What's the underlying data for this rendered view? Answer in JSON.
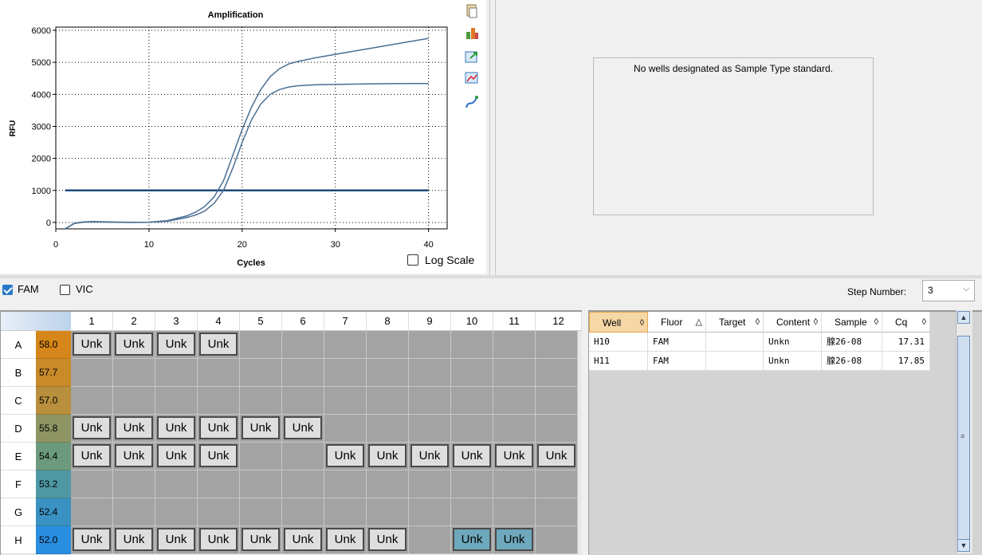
{
  "chart": {
    "title": "Amplification",
    "xlabel": "Cycles",
    "ylabel": "RFU",
    "log_scale_label": "Log Scale",
    "log_scale_checked": false
  },
  "chart_data": {
    "type": "line",
    "title": "Amplification",
    "xlabel": "Cycles",
    "ylabel": "RFU",
    "xlim": [
      0,
      42
    ],
    "ylim": [
      -200,
      6100
    ],
    "xticks": [
      0,
      10,
      20,
      30,
      40
    ],
    "yticks": [
      0,
      1000,
      2000,
      3000,
      4000,
      5000,
      6000
    ],
    "grid": "dotted",
    "threshold": 1000,
    "series": [
      {
        "color": "#4a6f93",
        "x": [
          1,
          2,
          3,
          4,
          6,
          8,
          10,
          12,
          14,
          15,
          16,
          17,
          18,
          19,
          20,
          21,
          22,
          23,
          24,
          25,
          26,
          28,
          30,
          32,
          34,
          36,
          38,
          40
        ],
        "y": [
          -200,
          -20,
          20,
          30,
          15,
          5,
          10,
          60,
          200,
          320,
          500,
          800,
          1300,
          2100,
          2900,
          3600,
          4150,
          4550,
          4800,
          4950,
          5030,
          5150,
          5250,
          5350,
          5450,
          5550,
          5650,
          5750
        ]
      },
      {
        "color": "#4a6f93",
        "x": [
          1,
          2,
          3,
          4,
          6,
          8,
          10,
          12,
          14,
          15,
          16,
          17,
          18,
          19,
          20,
          21,
          22,
          23,
          24,
          25,
          26,
          28,
          30,
          32,
          34,
          36,
          38,
          40
        ],
        "y": [
          -200,
          -30,
          10,
          20,
          10,
          0,
          5,
          40,
          150,
          230,
          360,
          600,
          1000,
          1700,
          2500,
          3200,
          3700,
          4000,
          4150,
          4230,
          4270,
          4300,
          4310,
          4320,
          4330,
          4335,
          4340,
          4340
        ]
      }
    ]
  },
  "standard_curve": {
    "message": "No wells designated as Sample Type standard."
  },
  "fluors": [
    {
      "label": "FAM",
      "checked": true
    },
    {
      "label": "VIC",
      "checked": false
    }
  ],
  "step": {
    "label": "Step Number:",
    "value": "3"
  },
  "plate": {
    "columns": [
      "1",
      "2",
      "3",
      "4",
      "5",
      "6",
      "7",
      "8",
      "9",
      "10",
      "11",
      "12"
    ],
    "rows": [
      {
        "label": "A",
        "temp": "58.0",
        "color": "#d6861a",
        "wells": [
          "Unk",
          "Unk",
          "Unk",
          "Unk",
          "",
          "",
          "",
          "",
          "",
          "",
          "",
          ""
        ],
        "selected": []
      },
      {
        "label": "B",
        "temp": "57.7",
        "color": "#c98a2a",
        "wells": [
          "",
          "",
          "",
          "",
          "",
          "",
          "",
          "",
          "",
          "",
          "",
          ""
        ],
        "selected": []
      },
      {
        "label": "C",
        "temp": "57.0",
        "color": "#b88f3d",
        "wells": [
          "",
          "",
          "",
          "",
          "",
          "",
          "",
          "",
          "",
          "",
          "",
          ""
        ],
        "selected": []
      },
      {
        "label": "D",
        "temp": "55.8",
        "color": "#8e9464",
        "wells": [
          "Unk",
          "Unk",
          "Unk",
          "Unk",
          "Unk",
          "Unk",
          "",
          "",
          "",
          "",
          "",
          ""
        ],
        "selected": []
      },
      {
        "label": "E",
        "temp": "54.4",
        "color": "#6c9a7e",
        "wells": [
          "Unk",
          "Unk",
          "Unk",
          "Unk",
          "",
          "",
          "Unk",
          "Unk",
          "Unk",
          "Unk",
          "Unk",
          "Unk"
        ],
        "selected": []
      },
      {
        "label": "F",
        "temp": "53.2",
        "color": "#4e98a4",
        "wells": [
          "",
          "",
          "",
          "",
          "",
          "",
          "",
          "",
          "",
          "",
          "",
          ""
        ],
        "selected": []
      },
      {
        "label": "G",
        "temp": "52.4",
        "color": "#3a92c2",
        "wells": [
          "",
          "",
          "",
          "",
          "",
          "",
          "",
          "",
          "",
          "",
          "",
          ""
        ],
        "selected": []
      },
      {
        "label": "H",
        "temp": "52.0",
        "color": "#2a8ee0",
        "wells": [
          "Unk",
          "Unk",
          "Unk",
          "Unk",
          "Unk",
          "Unk",
          "Unk",
          "Unk",
          "",
          "Unk",
          "Unk",
          ""
        ],
        "selected": [
          9,
          10
        ]
      }
    ]
  },
  "results_table": {
    "columns": [
      {
        "label": "Well",
        "sort": "◊"
      },
      {
        "label": "Fluor",
        "sort": "△"
      },
      {
        "label": "Target",
        "sort": "◊"
      },
      {
        "label": "Content",
        "sort": "◊"
      },
      {
        "label": "Sample",
        "sort": "◊"
      },
      {
        "label": "Cq",
        "sort": "◊"
      }
    ],
    "rows": [
      [
        "H10",
        "FAM",
        "",
        "Unkn",
        "腺26-08",
        "17.31"
      ],
      [
        "H11",
        "FAM",
        "",
        "Unkn",
        "腺26-08",
        "17.85"
      ]
    ]
  }
}
